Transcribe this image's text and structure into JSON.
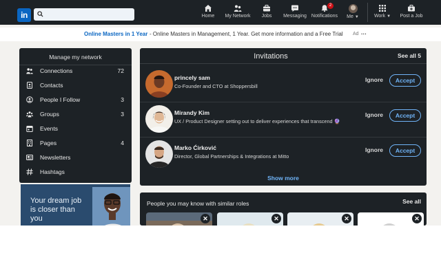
{
  "nav": {
    "logo": "in",
    "search_placeholder": "",
    "items": [
      {
        "label": "Home",
        "icon": "home-icon"
      },
      {
        "label": "My Network",
        "icon": "network-icon"
      },
      {
        "label": "Jobs",
        "icon": "briefcase-icon"
      },
      {
        "label": "Messaging",
        "icon": "chat-icon"
      },
      {
        "label": "Notifications",
        "icon": "bell-icon",
        "badge": "2"
      },
      {
        "label": "Me",
        "icon": "avatar"
      },
      {
        "label": "Work",
        "icon": "grid-icon"
      },
      {
        "label": "Post a Job",
        "icon": "briefcase-plus-icon"
      }
    ]
  },
  "ad": {
    "link": "Online Masters in 1 Year",
    "text": " - Online Masters in Management, 1 Year. Get more information and a Free Trial",
    "tag": "Ad",
    "more": "···"
  },
  "network": {
    "title": "Manage my network",
    "items": [
      {
        "label": "Connections",
        "count": "72",
        "icon": "people-icon"
      },
      {
        "label": "Contacts",
        "count": "",
        "icon": "contact-card-icon"
      },
      {
        "label": "People I Follow",
        "count": "3",
        "icon": "person-follow-icon"
      },
      {
        "label": "Groups",
        "count": "3",
        "icon": "groups-icon"
      },
      {
        "label": "Events",
        "count": "",
        "icon": "calendar-icon"
      },
      {
        "label": "Pages",
        "count": "4",
        "icon": "building-icon"
      },
      {
        "label": "Newsletters",
        "count": "",
        "icon": "newsletter-icon"
      },
      {
        "label": "Hashtags",
        "count": "",
        "icon": "hashtag-icon"
      }
    ]
  },
  "promo": {
    "text": "Your dream job is closer than you"
  },
  "invitations": {
    "title": "Invitations",
    "see_all": "See all 5",
    "ignore_label": "Ignore",
    "accept_label": "Accept",
    "show_more": "Show more",
    "items": [
      {
        "name": "princely sam",
        "headline": "Co-Founder and CTO at Shoppersbill"
      },
      {
        "name": "Mirandy Kim",
        "headline": "UX / Product Designer setting out to deliver experiences that transcend 🔮"
      },
      {
        "name": "Marko Ćirković",
        "headline": "Director, Global Partnerships & Integrations at Mitto"
      }
    ]
  },
  "people": {
    "title": "People you may know with similar roles",
    "see_all": "See all",
    "dismiss": "✕"
  },
  "colors": {
    "nav_bg": "#1d2226",
    "card_bg": "#1d2226",
    "brand": "#0a66c2",
    "accent": "#70b5f9",
    "notification_badge": "#cc1016"
  }
}
